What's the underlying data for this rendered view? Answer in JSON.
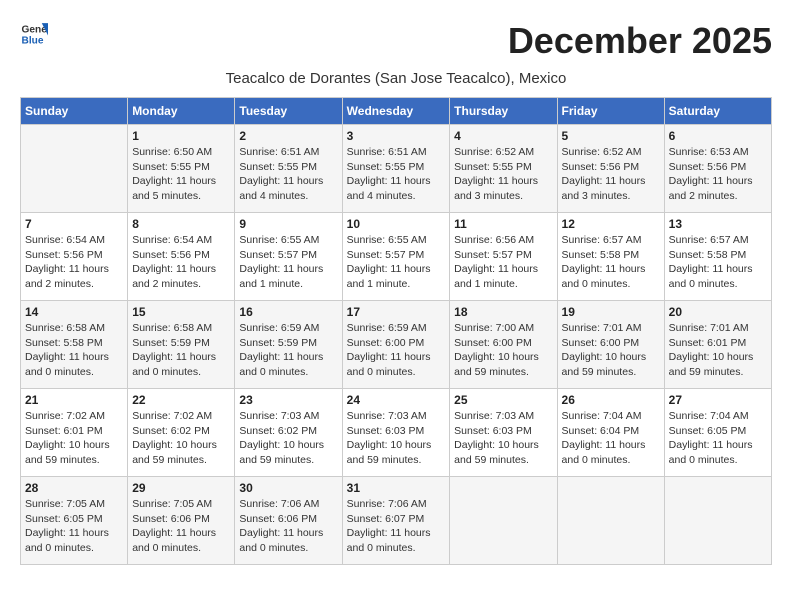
{
  "header": {
    "logo_general": "General",
    "logo_blue": "Blue",
    "month_title": "December 2025",
    "subtitle": "Teacalco de Dorantes (San Jose Teacalco), Mexico"
  },
  "days_of_week": [
    "Sunday",
    "Monday",
    "Tuesday",
    "Wednesday",
    "Thursday",
    "Friday",
    "Saturday"
  ],
  "weeks": [
    [
      {
        "day": "",
        "info": ""
      },
      {
        "day": "1",
        "info": "Sunrise: 6:50 AM\nSunset: 5:55 PM\nDaylight: 11 hours\nand 5 minutes."
      },
      {
        "day": "2",
        "info": "Sunrise: 6:51 AM\nSunset: 5:55 PM\nDaylight: 11 hours\nand 4 minutes."
      },
      {
        "day": "3",
        "info": "Sunrise: 6:51 AM\nSunset: 5:55 PM\nDaylight: 11 hours\nand 4 minutes."
      },
      {
        "day": "4",
        "info": "Sunrise: 6:52 AM\nSunset: 5:55 PM\nDaylight: 11 hours\nand 3 minutes."
      },
      {
        "day": "5",
        "info": "Sunrise: 6:52 AM\nSunset: 5:56 PM\nDaylight: 11 hours\nand 3 minutes."
      },
      {
        "day": "6",
        "info": "Sunrise: 6:53 AM\nSunset: 5:56 PM\nDaylight: 11 hours\nand 2 minutes."
      }
    ],
    [
      {
        "day": "7",
        "info": "Sunrise: 6:54 AM\nSunset: 5:56 PM\nDaylight: 11 hours\nand 2 minutes."
      },
      {
        "day": "8",
        "info": "Sunrise: 6:54 AM\nSunset: 5:56 PM\nDaylight: 11 hours\nand 2 minutes."
      },
      {
        "day": "9",
        "info": "Sunrise: 6:55 AM\nSunset: 5:57 PM\nDaylight: 11 hours\nand 1 minute."
      },
      {
        "day": "10",
        "info": "Sunrise: 6:55 AM\nSunset: 5:57 PM\nDaylight: 11 hours\nand 1 minute."
      },
      {
        "day": "11",
        "info": "Sunrise: 6:56 AM\nSunset: 5:57 PM\nDaylight: 11 hours\nand 1 minute."
      },
      {
        "day": "12",
        "info": "Sunrise: 6:57 AM\nSunset: 5:58 PM\nDaylight: 11 hours\nand 0 minutes."
      },
      {
        "day": "13",
        "info": "Sunrise: 6:57 AM\nSunset: 5:58 PM\nDaylight: 11 hours\nand 0 minutes."
      }
    ],
    [
      {
        "day": "14",
        "info": "Sunrise: 6:58 AM\nSunset: 5:58 PM\nDaylight: 11 hours\nand 0 minutes."
      },
      {
        "day": "15",
        "info": "Sunrise: 6:58 AM\nSunset: 5:59 PM\nDaylight: 11 hours\nand 0 minutes."
      },
      {
        "day": "16",
        "info": "Sunrise: 6:59 AM\nSunset: 5:59 PM\nDaylight: 11 hours\nand 0 minutes."
      },
      {
        "day": "17",
        "info": "Sunrise: 6:59 AM\nSunset: 6:00 PM\nDaylight: 11 hours\nand 0 minutes."
      },
      {
        "day": "18",
        "info": "Sunrise: 7:00 AM\nSunset: 6:00 PM\nDaylight: 10 hours\nand 59 minutes."
      },
      {
        "day": "19",
        "info": "Sunrise: 7:01 AM\nSunset: 6:00 PM\nDaylight: 10 hours\nand 59 minutes."
      },
      {
        "day": "20",
        "info": "Sunrise: 7:01 AM\nSunset: 6:01 PM\nDaylight: 10 hours\nand 59 minutes."
      }
    ],
    [
      {
        "day": "21",
        "info": "Sunrise: 7:02 AM\nSunset: 6:01 PM\nDaylight: 10 hours\nand 59 minutes."
      },
      {
        "day": "22",
        "info": "Sunrise: 7:02 AM\nSunset: 6:02 PM\nDaylight: 10 hours\nand 59 minutes."
      },
      {
        "day": "23",
        "info": "Sunrise: 7:03 AM\nSunset: 6:02 PM\nDaylight: 10 hours\nand 59 minutes."
      },
      {
        "day": "24",
        "info": "Sunrise: 7:03 AM\nSunset: 6:03 PM\nDaylight: 10 hours\nand 59 minutes."
      },
      {
        "day": "25",
        "info": "Sunrise: 7:03 AM\nSunset: 6:03 PM\nDaylight: 10 hours\nand 59 minutes."
      },
      {
        "day": "26",
        "info": "Sunrise: 7:04 AM\nSunset: 6:04 PM\nDaylight: 11 hours\nand 0 minutes."
      },
      {
        "day": "27",
        "info": "Sunrise: 7:04 AM\nSunset: 6:05 PM\nDaylight: 11 hours\nand 0 minutes."
      }
    ],
    [
      {
        "day": "28",
        "info": "Sunrise: 7:05 AM\nSunset: 6:05 PM\nDaylight: 11 hours\nand 0 minutes."
      },
      {
        "day": "29",
        "info": "Sunrise: 7:05 AM\nSunset: 6:06 PM\nDaylight: 11 hours\nand 0 minutes."
      },
      {
        "day": "30",
        "info": "Sunrise: 7:06 AM\nSunset: 6:06 PM\nDaylight: 11 hours\nand 0 minutes."
      },
      {
        "day": "31",
        "info": "Sunrise: 7:06 AM\nSunset: 6:07 PM\nDaylight: 11 hours\nand 0 minutes."
      },
      {
        "day": "",
        "info": ""
      },
      {
        "day": "",
        "info": ""
      },
      {
        "day": "",
        "info": ""
      }
    ]
  ]
}
